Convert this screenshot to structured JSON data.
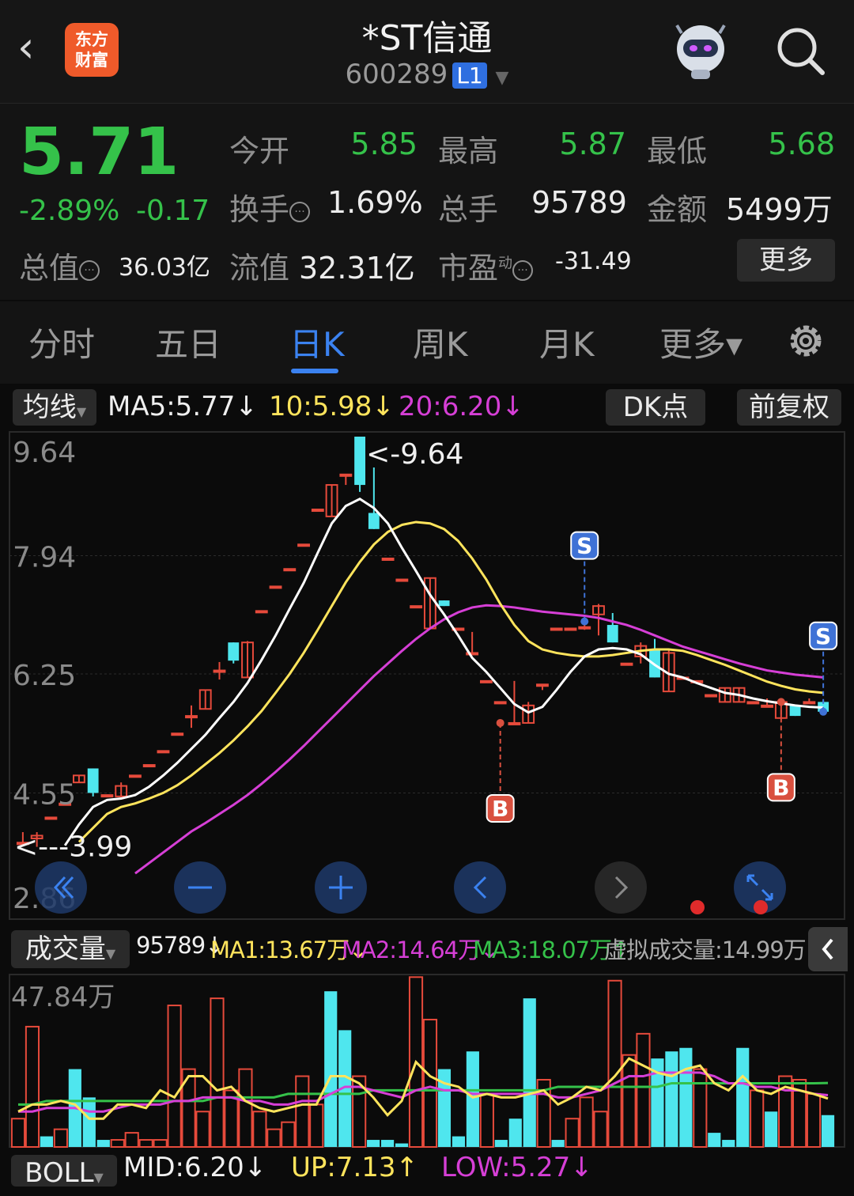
{
  "header": {
    "back_icon": "chevron-left-icon",
    "logo_line1": "东方",
    "logo_line2": "财富",
    "title": "*ST信通",
    "code": "600289",
    "level_badge": "L1",
    "assistant_icon": "robot-icon",
    "search_icon": "search-icon"
  },
  "quote": {
    "price": "5.71",
    "change_pct": "-2.89%",
    "change": "-0.17",
    "open_label": "今开",
    "open": "5.85",
    "high_label": "最高",
    "high": "5.87",
    "low_label": "最低",
    "low": "5.68",
    "turnover_label": "换手",
    "turnover": "1.69%",
    "volume_label": "总手",
    "volume": "95789",
    "amount_label": "金额",
    "amount": "5499万",
    "total_cap_label": "总值",
    "total_cap": "36.03亿",
    "float_cap_label": "流值",
    "float_cap": "32.31亿",
    "pe_label": "市盈",
    "pe_sup": "动",
    "pe": "-31.49",
    "more_button": "更多"
  },
  "tabs": [
    {
      "label": "分时",
      "active": false
    },
    {
      "label": "五日",
      "active": false
    },
    {
      "label": "日K",
      "active": true
    },
    {
      "label": "周K",
      "active": false
    },
    {
      "label": "月K",
      "active": false
    },
    {
      "label": "更多▾",
      "active": false
    }
  ],
  "settings_icon": "gear-icon",
  "ma_bar": {
    "selector": "均线",
    "ma5": "MA5:5.77↓",
    "ma10": "10:5.98↓",
    "ma20": "20:6.20↓",
    "dk_button": "DK点",
    "adjust_button": "前复权"
  },
  "colors": {
    "up": "#e64a3b",
    "down": "#4fe6ee",
    "ma5": "#ffffff",
    "ma10": "#ffe45c",
    "ma20": "#d63fd6",
    "green": "#35c24a",
    "accent": "#3b82f0"
  },
  "chart_data": [
    {
      "type": "candlestick",
      "y_ticks": [
        "9.64",
        "7.94",
        "6.25",
        "4.55",
        "2.86"
      ],
      "ylim": [
        2.86,
        9.64
      ],
      "annotations": {
        "high": "<-9.64",
        "low": "<---3.99",
        "sell_markers": [
          "S",
          "S"
        ],
        "buy_markers": [
          "B",
          "B"
        ]
      },
      "candles": [
        {
          "o": 3.84,
          "h": 3.99,
          "l": 3.84,
          "c": 3.84
        },
        {
          "o": 3.9,
          "h": 3.99,
          "l": 3.78,
          "c": 3.94
        },
        {
          "o": 4.2,
          "h": 4.2,
          "l": 4.2,
          "c": 4.2
        },
        {
          "o": 4.4,
          "h": 4.4,
          "l": 4.4,
          "c": 4.4
        },
        {
          "o": 4.7,
          "h": 4.8,
          "l": 4.7,
          "c": 4.8
        },
        {
          "o": 4.9,
          "h": 4.9,
          "l": 4.5,
          "c": 4.55
        },
        {
          "o": 4.52,
          "h": 4.52,
          "l": 4.52,
          "c": 4.52
        },
        {
          "o": 4.5,
          "h": 4.7,
          "l": 4.5,
          "c": 4.65
        },
        {
          "o": 4.8,
          "h": 4.8,
          "l": 4.8,
          "c": 4.8
        },
        {
          "o": 4.95,
          "h": 4.95,
          "l": 4.95,
          "c": 4.95
        },
        {
          "o": 5.15,
          "h": 5.15,
          "l": 5.15,
          "c": 5.15
        },
        {
          "o": 5.4,
          "h": 5.4,
          "l": 5.4,
          "c": 5.4
        },
        {
          "o": 5.65,
          "h": 5.8,
          "l": 5.48,
          "c": 5.65
        },
        {
          "o": 5.75,
          "h": 6.02,
          "l": 5.75,
          "c": 6.02
        },
        {
          "o": 6.3,
          "h": 6.42,
          "l": 6.17,
          "c": 6.3
        },
        {
          "o": 6.7,
          "h": 6.7,
          "l": 6.4,
          "c": 6.44
        },
        {
          "o": 6.2,
          "h": 6.72,
          "l": 6.2,
          "c": 6.7
        },
        {
          "o": 7.15,
          "h": 7.15,
          "l": 7.15,
          "c": 7.15
        },
        {
          "o": 7.5,
          "h": 7.5,
          "l": 7.5,
          "c": 7.5
        },
        {
          "o": 7.75,
          "h": 7.75,
          "l": 7.75,
          "c": 7.75
        },
        {
          "o": 8.1,
          "h": 8.1,
          "l": 8.1,
          "c": 8.1
        },
        {
          "o": 8.6,
          "h": 8.6,
          "l": 8.6,
          "c": 8.6
        },
        {
          "o": 8.5,
          "h": 8.95,
          "l": 8.5,
          "c": 8.95
        },
        {
          "o": 9.1,
          "h": 9.1,
          "l": 8.95,
          "c": 9.1
        },
        {
          "o": 9.64,
          "h": 9.64,
          "l": 8.85,
          "c": 8.95
        },
        {
          "o": 8.55,
          "h": 9.2,
          "l": 8.32,
          "c": 8.32
        },
        {
          "o": 7.9,
          "h": 7.9,
          "l": 7.9,
          "c": 7.9
        },
        {
          "o": 7.6,
          "h": 7.6,
          "l": 7.6,
          "c": 7.6
        },
        {
          "o": 7.22,
          "h": 7.22,
          "l": 7.22,
          "c": 7.22
        },
        {
          "o": 6.9,
          "h": 7.62,
          "l": 6.9,
          "c": 7.62
        },
        {
          "o": 7.3,
          "h": 7.3,
          "l": 7.22,
          "c": 7.22
        },
        {
          "o": 6.9,
          "h": 6.9,
          "l": 6.9,
          "c": 6.9
        },
        {
          "o": 6.55,
          "h": 6.85,
          "l": 6.55,
          "c": 6.55
        },
        {
          "o": 6.15,
          "h": 6.15,
          "l": 6.15,
          "c": 6.15
        },
        {
          "o": 5.85,
          "h": 5.85,
          "l": 5.85,
          "c": 5.85
        },
        {
          "o": 5.55,
          "h": 6.15,
          "l": 5.55,
          "c": 5.55
        },
        {
          "o": 5.55,
          "h": 5.85,
          "l": 5.55,
          "c": 5.8
        },
        {
          "o": 6.1,
          "h": 6.1,
          "l": 6.02,
          "c": 6.1
        },
        {
          "o": 6.9,
          "h": 6.9,
          "l": 6.9,
          "c": 6.9
        },
        {
          "o": 6.9,
          "h": 6.9,
          "l": 6.9,
          "c": 6.9
        },
        {
          "o": 6.92,
          "h": 7.0,
          "l": 6.88,
          "c": 6.92
        },
        {
          "o": 7.1,
          "h": 7.25,
          "l": 6.8,
          "c": 7.22
        },
        {
          "o": 6.95,
          "h": 7.12,
          "l": 6.7,
          "c": 6.7
        },
        {
          "o": 6.4,
          "h": 6.4,
          "l": 6.4,
          "c": 6.4
        },
        {
          "o": 6.5,
          "h": 6.7,
          "l": 6.4,
          "c": 6.65
        },
        {
          "o": 6.6,
          "h": 6.75,
          "l": 6.2,
          "c": 6.2
        },
        {
          "o": 6.0,
          "h": 6.6,
          "l": 6.0,
          "c": 6.55
        },
        {
          "o": 6.2,
          "h": 6.2,
          "l": 6.2,
          "c": 6.2
        },
        {
          "o": 6.15,
          "h": 6.15,
          "l": 6.15,
          "c": 6.15
        },
        {
          "o": 5.95,
          "h": 5.95,
          "l": 5.95,
          "c": 5.95
        },
        {
          "o": 5.85,
          "h": 6.05,
          "l": 5.85,
          "c": 6.05
        },
        {
          "o": 5.85,
          "h": 6.05,
          "l": 5.85,
          "c": 6.05
        },
        {
          "o": 5.85,
          "h": 5.85,
          "l": 5.85,
          "c": 5.85
        },
        {
          "o": 5.8,
          "h": 5.9,
          "l": 5.8,
          "c": 5.8
        },
        {
          "o": 5.62,
          "h": 5.9,
          "l": 5.62,
          "c": 5.85
        },
        {
          "o": 5.8,
          "h": 5.8,
          "l": 5.65,
          "c": 5.65
        },
        {
          "o": 5.85,
          "h": 5.9,
          "l": 5.85,
          "c": 5.85
        },
        {
          "o": 5.85,
          "h": 5.87,
          "l": 5.68,
          "c": 5.71
        }
      ],
      "ma5": [
        3.8,
        4.1,
        4.35,
        4.45,
        4.47,
        4.52,
        4.64,
        4.8,
        4.98,
        5.18,
        5.38,
        5.62,
        5.85,
        6.12,
        6.45,
        6.8,
        7.18,
        7.55,
        7.98,
        8.4,
        8.65,
        8.75,
        8.62,
        8.4,
        8.05,
        7.72,
        7.38,
        7.1,
        6.8,
        6.48,
        6.28,
        6.05,
        5.82,
        5.7,
        5.78,
        6.02,
        6.28,
        6.5,
        6.6,
        6.62,
        6.6,
        6.53,
        6.38,
        6.25,
        6.2,
        6.12,
        6.05,
        5.98,
        5.95,
        5.9,
        5.86,
        5.83,
        5.8,
        5.78,
        5.77
      ],
      "ma10": [
        3.85,
        4.05,
        4.25,
        4.35,
        4.4,
        4.47,
        4.55,
        4.66,
        4.8,
        4.96,
        5.12,
        5.3,
        5.5,
        5.72,
        5.98,
        6.25,
        6.55,
        6.88,
        7.22,
        7.56,
        7.85,
        8.1,
        8.28,
        8.38,
        8.42,
        8.4,
        8.32,
        8.15,
        7.9,
        7.6,
        7.25,
        6.95,
        6.72,
        6.6,
        6.55,
        6.52,
        6.5,
        6.5,
        6.52,
        6.55,
        6.58,
        6.6,
        6.6,
        6.58,
        6.52,
        6.45,
        6.38,
        6.3,
        6.22,
        6.14,
        6.08,
        6.03,
        6.0,
        5.98
      ],
      "ma20": [
        3.4,
        3.55,
        3.7,
        3.85,
        4.0,
        4.12,
        4.25,
        4.38,
        4.52,
        4.68,
        4.85,
        5.03,
        5.22,
        5.42,
        5.62,
        5.82,
        6.02,
        6.22,
        6.4,
        6.58,
        6.75,
        6.9,
        7.03,
        7.13,
        7.2,
        7.23,
        7.22,
        7.2,
        7.17,
        7.14,
        7.12,
        7.1,
        7.08,
        7.05,
        7.0,
        6.95,
        6.88,
        6.8,
        6.72,
        6.64,
        6.58,
        6.52,
        6.46,
        6.4,
        6.35,
        6.3,
        6.27,
        6.24,
        6.22,
        6.2
      ]
    },
    {
      "type": "bar",
      "name": "成交量",
      "y_ticks": [
        "47.84万"
      ],
      "ylim": [
        0,
        47.84
      ],
      "unit": "万",
      "labels": {
        "selector": "成交量",
        "volume": "95789↓",
        "ma1": "MA1:13.67万↓",
        "ma2": "MA2:14.64万↓",
        "ma3": "MA3:18.07万↑",
        "virtual": "虚拟成交量:14.99万"
      },
      "bars": [
        {
          "v": 8,
          "up": true
        },
        {
          "v": 34,
          "up": true
        },
        {
          "v": 3,
          "up": false
        },
        {
          "v": 5,
          "up": true
        },
        {
          "v": 22,
          "up": false
        },
        {
          "v": 14,
          "up": false
        },
        {
          "v": 2,
          "up": false
        },
        {
          "v": 2,
          "up": true
        },
        {
          "v": 4,
          "up": true
        },
        {
          "v": 2,
          "up": true
        },
        {
          "v": 2,
          "up": true
        },
        {
          "v": 40,
          "up": true
        },
        {
          "v": 22,
          "up": true
        },
        {
          "v": 10,
          "up": true
        },
        {
          "v": 42,
          "up": true
        },
        {
          "v": 16,
          "up": true
        },
        {
          "v": 22,
          "up": true
        },
        {
          "v": 10,
          "up": true
        },
        {
          "v": 5,
          "up": true
        },
        {
          "v": 7,
          "up": true
        },
        {
          "v": 20,
          "up": true
        },
        {
          "v": 12,
          "up": true
        },
        {
          "v": 44,
          "up": false
        },
        {
          "v": 33,
          "up": false
        },
        {
          "v": 20,
          "up": true
        },
        {
          "v": 2,
          "up": false
        },
        {
          "v": 2,
          "up": false
        },
        {
          "v": 1,
          "up": false
        },
        {
          "v": 48,
          "up": true
        },
        {
          "v": 36,
          "up": true
        },
        {
          "v": 22,
          "up": false
        },
        {
          "v": 3,
          "up": false
        },
        {
          "v": 27,
          "up": false
        },
        {
          "v": 15,
          "up": true
        },
        {
          "v": 2,
          "up": false
        },
        {
          "v": 8,
          "up": false
        },
        {
          "v": 42,
          "up": false
        },
        {
          "v": 19,
          "up": true
        },
        {
          "v": 2,
          "up": false
        },
        {
          "v": 8,
          "up": true
        },
        {
          "v": 14,
          "up": true
        },
        {
          "v": 10,
          "up": true
        },
        {
          "v": 47,
          "up": true
        },
        {
          "v": 26,
          "up": true
        },
        {
          "v": 32,
          "up": true
        },
        {
          "v": 25,
          "up": false
        },
        {
          "v": 27,
          "up": false
        },
        {
          "v": 28,
          "up": false
        },
        {
          "v": 22,
          "up": true
        },
        {
          "v": 4,
          "up": false
        },
        {
          "v": 2,
          "up": false
        },
        {
          "v": 28,
          "up": false
        },
        {
          "v": 16,
          "up": true
        },
        {
          "v": 10,
          "up": false
        },
        {
          "v": 20,
          "up": true
        },
        {
          "v": 19,
          "up": true
        },
        {
          "v": 15,
          "up": true
        },
        {
          "v": 9,
          "up": false
        }
      ],
      "ma1": [
        10,
        12,
        12,
        13,
        12,
        8,
        8,
        12,
        12,
        11,
        16,
        14,
        20,
        20,
        16,
        17,
        13,
        11,
        10,
        11,
        12,
        12,
        20,
        20,
        18,
        14,
        9,
        13,
        24,
        20,
        18,
        17,
        14,
        15,
        14,
        14,
        15,
        16,
        12,
        14,
        17,
        16,
        20,
        25,
        23,
        21,
        20,
        22,
        23,
        18,
        16,
        20,
        16,
        15,
        17,
        16,
        15,
        13.67
      ],
      "ma2": [
        10,
        10,
        11,
        11,
        11,
        10,
        10,
        11,
        12,
        12,
        12,
        13,
        13,
        14,
        14,
        14,
        13,
        13,
        12,
        12,
        13,
        13,
        15,
        17,
        17,
        16,
        15,
        14,
        16,
        17,
        16,
        16,
        15,
        15,
        15,
        15,
        15,
        15,
        14,
        14,
        15,
        16,
        18,
        20,
        20,
        21,
        21,
        21,
        21,
        20,
        18,
        18,
        17,
        17,
        16,
        16,
        15,
        14.64
      ],
      "ma3": [
        12,
        12,
        13,
        13,
        13,
        13,
        13,
        13,
        13,
        13,
        13,
        13,
        13,
        13,
        14,
        14,
        14,
        14,
        14,
        15,
        15,
        15,
        15,
        15,
        15,
        16,
        16,
        16,
        16,
        16,
        16,
        16,
        16,
        16,
        16,
        16,
        16,
        16,
        17,
        17,
        17,
        17,
        17,
        17,
        17,
        17,
        18,
        18,
        18,
        18,
        18,
        18,
        18,
        18,
        18,
        18,
        18,
        18.07
      ]
    }
  ],
  "chart_controls": [
    "fast-backward-icon",
    "zoom-out-icon",
    "zoom-in-icon",
    "chevron-left-icon",
    "chevron-right-icon",
    "expand-icon"
  ],
  "boll_bar": {
    "selector": "BOLL",
    "mid": "MID:6.20↓",
    "up": "UP:7.13↑",
    "low": "LOW:5.27↓"
  }
}
